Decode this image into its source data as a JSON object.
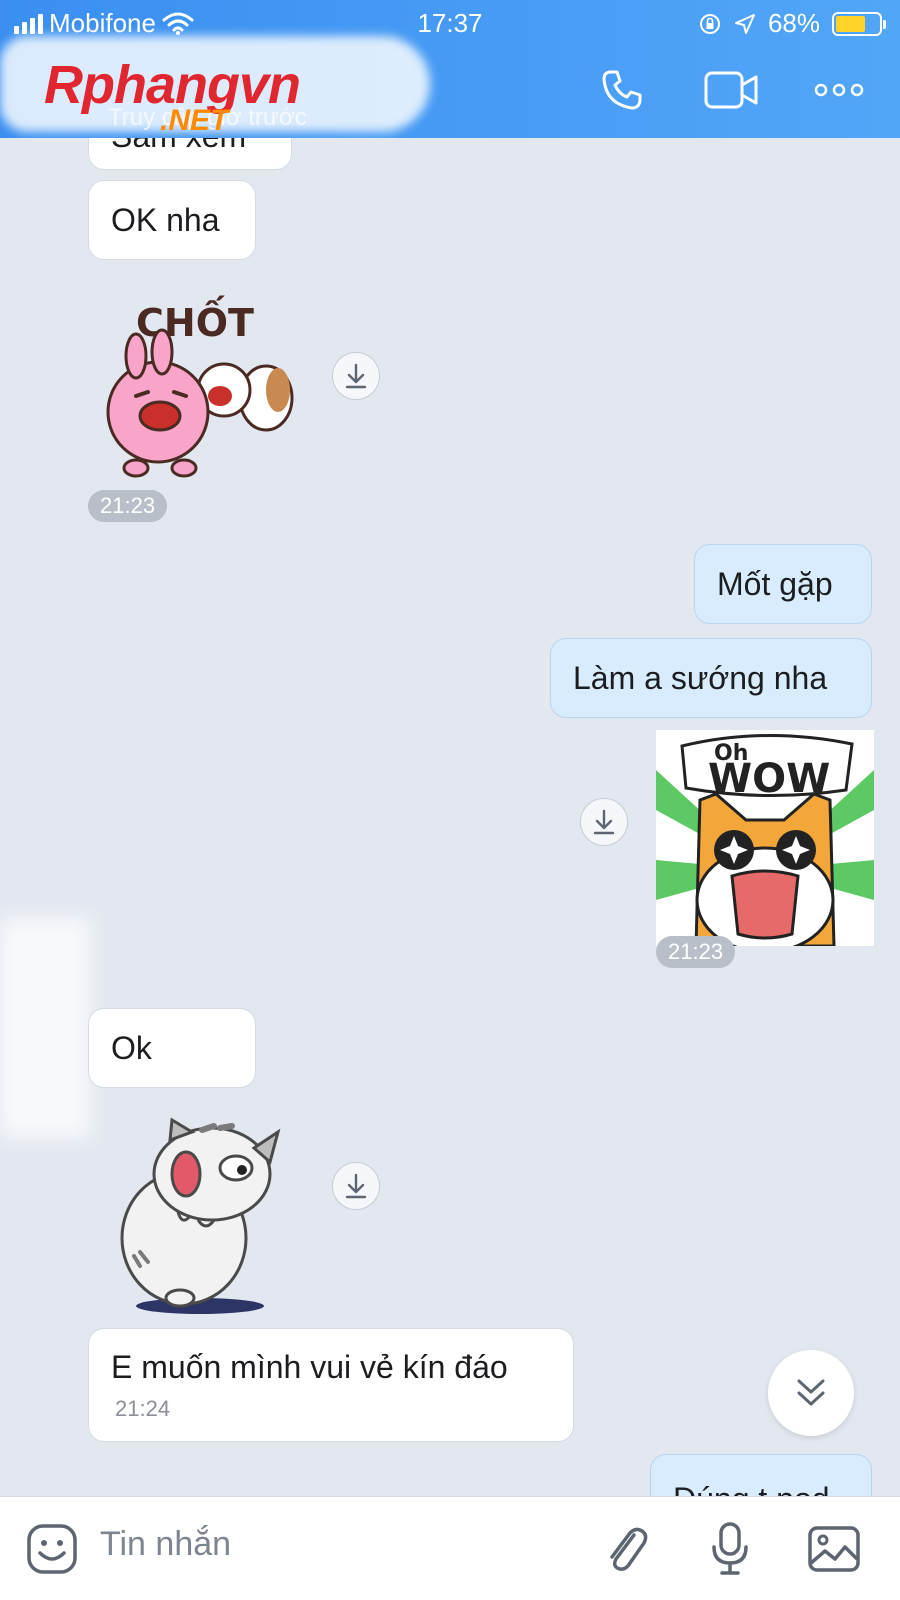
{
  "status_bar": {
    "carrier": "Mobifone",
    "time": "17:37",
    "battery_percent": "68%",
    "battery_level": 0.68
  },
  "header": {
    "brand": "Rphangvn",
    "brand_sub": ".NET",
    "subtitle": "Truy cập giờ trước",
    "icons": [
      "phone-icon",
      "video-icon",
      "more-icon"
    ]
  },
  "messages": [
    {
      "from": "them",
      "type": "text",
      "text": "Sắm xem"
    },
    {
      "from": "them",
      "type": "text",
      "text": "OK nha"
    },
    {
      "from": "them",
      "type": "sticker",
      "caption": "CHỐT"
    },
    {
      "from": "them",
      "type": "time",
      "text": "21:23"
    },
    {
      "from": "me",
      "type": "text",
      "text": "Mốt gặp"
    },
    {
      "from": "me",
      "type": "text",
      "text": "Làm a sướng nha"
    },
    {
      "from": "me",
      "type": "sticker",
      "caption_top": "Oh",
      "caption_main": "WOW"
    },
    {
      "from": "me",
      "type": "time",
      "text": "21:23"
    },
    {
      "from": "them",
      "type": "text",
      "text": "Ok"
    },
    {
      "from": "them",
      "type": "sticker",
      "caption": ""
    },
    {
      "from": "them",
      "type": "text_with_time",
      "text": "E muốn mình vui vẻ kín đáo",
      "time": "21:24"
    },
    {
      "from": "me",
      "type": "text",
      "text": "Đúng t nod"
    }
  ],
  "composer": {
    "placeholder": "Tin nhắn",
    "icons": [
      "emoji-icon",
      "attachment-icon",
      "microphone-icon",
      "image-icon"
    ]
  },
  "colors": {
    "header_gradient_start": "#3a8ff1",
    "header_gradient_end": "#52a6f8",
    "chat_background": "#e3e8f0",
    "my_bubble": "#d9ecfd",
    "their_bubble": "#ffffff",
    "brand_red": "#e0262f",
    "brand_orange": "#ff8a00"
  }
}
